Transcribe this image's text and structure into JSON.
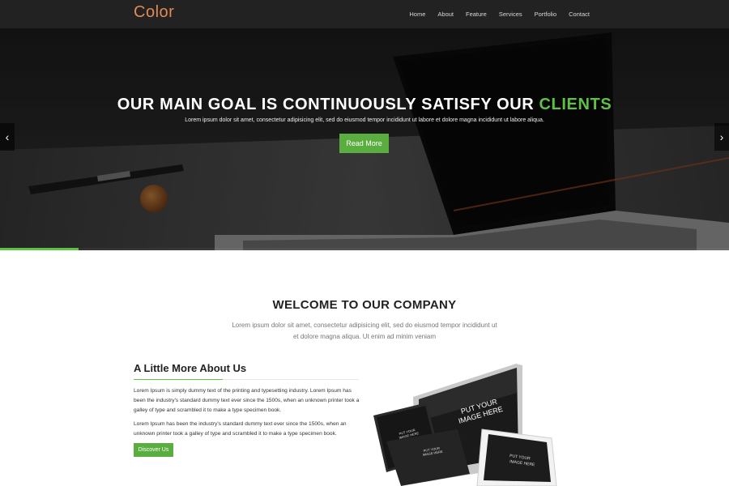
{
  "navbar": {
    "logo": "Color",
    "items": [
      {
        "label": "Home"
      },
      {
        "label": "About"
      },
      {
        "label": "Feature"
      },
      {
        "label": "Services"
      },
      {
        "label": "Portfolio"
      },
      {
        "label": "Contact"
      }
    ]
  },
  "hero": {
    "title_main": "OUR MAIN GOAL IS CONTINUOUSLY SATISFY OUR ",
    "title_accent": "CLIENTS",
    "subtitle": "Lorem ipsum dolor sit amet, consectetur adipisicing elit, sed do eiusmod tempor incididunt ut labore et dolore magna incididunt ut labore aliqua.",
    "button_label": "Read More",
    "prev_arrow": "‹",
    "next_arrow": "›",
    "slide_progress": 0.108
  },
  "welcome": {
    "title": "WELCOME TO OUR COMPANY",
    "text": "Lorem ipsum dolor sit amet, consectetur adipisicing elit, sed do eiusmod tempor incididunt ut et dolore magna aliqua. Ut enim ad minim veniam"
  },
  "about": {
    "title": "A Little More About Us",
    "paragraph1": "Lorem Ipsum is simply dummy text of the printing and typesetting industry. Lorem Ipsum has been the industry's standard dummy text ever since the 1500s, when an unknown printer took a galley of type and scrambled it to make a type specimen book.",
    "paragraph2": "Lorem Ipsum has been the industry's standard dummy text ever since the 1500s, when an unknown printer took a galley of type and scrambled it to make a type specimen book.",
    "button_label": "Discover Us"
  },
  "devices": {
    "monitor_text_1": "PUT YOUR",
    "monitor_text_2": "IMAGE HERE",
    "tablet_text_1": "PUT YOUR",
    "tablet_text_2": "IMAGE HERE",
    "small_text_1": "PUT YOUR",
    "small_text_2": "IMAGE HERE",
    "tiny_text_1": "PUT YOUR",
    "tiny_text_2": "IMAGE HERE"
  },
  "colors": {
    "accent": "#5ec244",
    "button": "#5aad3f",
    "logo": "#e08a55",
    "navbar": "#222222"
  }
}
